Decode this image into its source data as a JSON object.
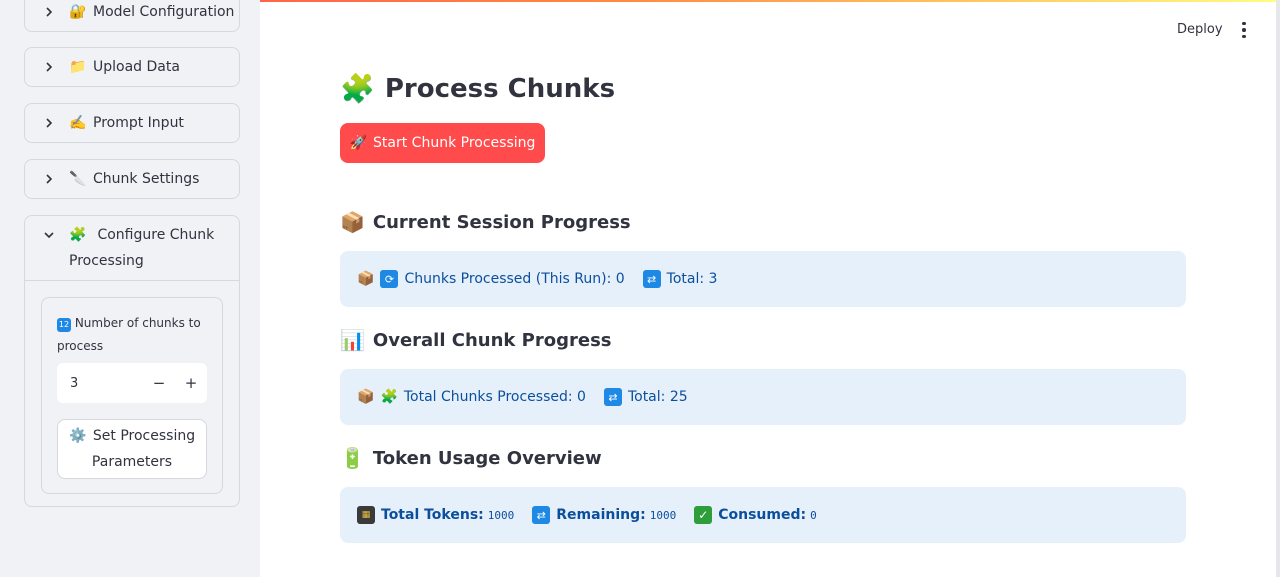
{
  "header": {
    "deploy_label": "Deploy",
    "menu_icon": "kebab-icon"
  },
  "sidebar": {
    "items": [
      {
        "label": "Model Configuration",
        "icon": "🔐"
      },
      {
        "label": "Upload Data",
        "icon": "📁"
      },
      {
        "label": "Prompt Input",
        "icon": "✍️"
      },
      {
        "label": "Chunk Settings",
        "icon": "🔪"
      }
    ],
    "open_section": {
      "label": "Configure Chunk Processing",
      "icon": "🧩",
      "number_label": "Number of chunks to process",
      "number_icon": "🔢",
      "number_value": "3",
      "minus": "−",
      "plus": "+",
      "set_button": "Set Processing Parameters",
      "set_icon": "⚙️"
    }
  },
  "main": {
    "title": "Process Chunks",
    "title_icon": "🧩",
    "start_button": "Start Chunk Processing",
    "start_icon": "🚀",
    "session": {
      "heading": "Current Session Progress",
      "heading_icon": "📦",
      "processed_text": "Chunks Processed (This Run): 0",
      "total_text": "Total: 3"
    },
    "overall": {
      "heading": "Overall Chunk Progress",
      "heading_icon": "📊",
      "processed_text": "Total Chunks Processed: 0",
      "total_text": "Total: 25"
    },
    "tokens": {
      "heading": "Token Usage Overview",
      "heading_icon": "🔋",
      "total_label": "Total Tokens:",
      "total_value": "1000",
      "remaining_label": "Remaining:",
      "remaining_value": "1000",
      "consumed_label": "Consumed:",
      "consumed_value": "0"
    }
  },
  "colors": {
    "primary": "#ff4b4b",
    "info_bg": "#e6f0fb",
    "info_text": "#0b4f9c",
    "sidebar_bg": "#f0f2f6"
  }
}
